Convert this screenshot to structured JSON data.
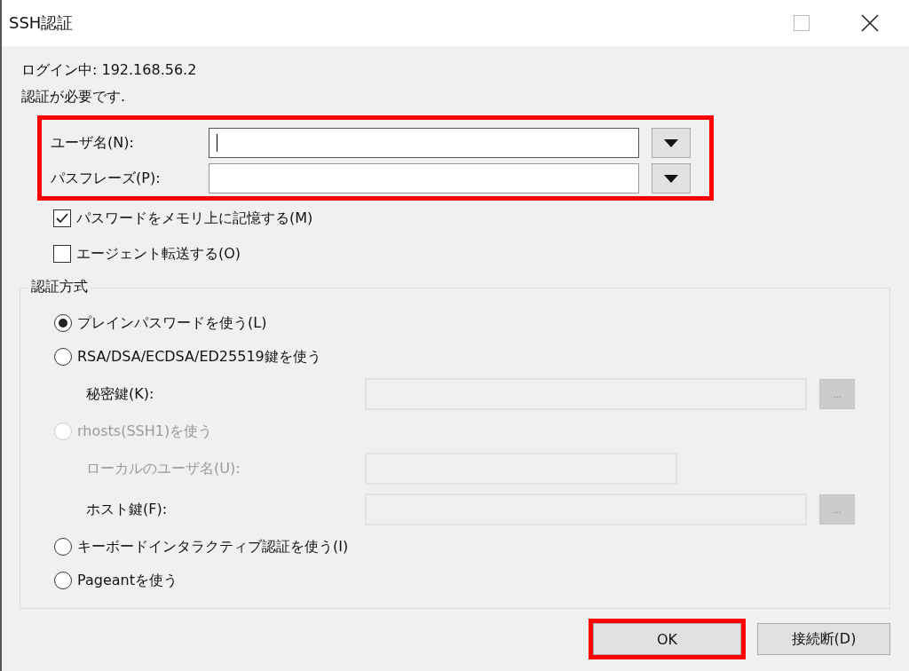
{
  "window": {
    "title": "SSH認証"
  },
  "login_text": "ログイン中: 192.168.56.2",
  "auth_required_text": "認証が必要です.",
  "credentials": {
    "highlighted": true,
    "fields": [
      {
        "label": "ユーザ名(N):",
        "focused": true
      },
      {
        "label": "パスフレーズ(P):",
        "focused": false
      }
    ]
  },
  "options": [
    {
      "label": "パスワードをメモリ上に記憶する(M)",
      "checked": true
    },
    {
      "label": "エージェント転送する(O)",
      "checked": false
    }
  ],
  "auth_method": {
    "title": "認証方式",
    "items": [
      {
        "kind": "radio",
        "label": "プレインパスワードを使う(L)",
        "selected": true,
        "disabled": false
      },
      {
        "kind": "radio",
        "label": "RSA/DSA/ECDSA/ED25519鍵を使う",
        "selected": false,
        "disabled": false
      },
      {
        "kind": "field",
        "label": "秘密鍵(K):",
        "disabled": false,
        "browse": "..."
      },
      {
        "kind": "radio",
        "label": "rhosts(SSH1)を使う",
        "selected": false,
        "disabled": true
      },
      {
        "kind": "field",
        "label": "ローカルのユーザ名(U):",
        "disabled": true
      },
      {
        "kind": "field",
        "label": "ホスト鍵(F):",
        "disabled": false,
        "browse": "..."
      },
      {
        "kind": "radio",
        "label": "キーボードインタラクティブ認証を使う(I)",
        "selected": false,
        "disabled": false
      },
      {
        "kind": "radio",
        "label": "Pageantを使う",
        "selected": false,
        "disabled": false
      }
    ]
  },
  "buttons": [
    {
      "label": "OK",
      "highlighted": true
    },
    {
      "label": "接続断(D)",
      "highlighted": false
    }
  ]
}
